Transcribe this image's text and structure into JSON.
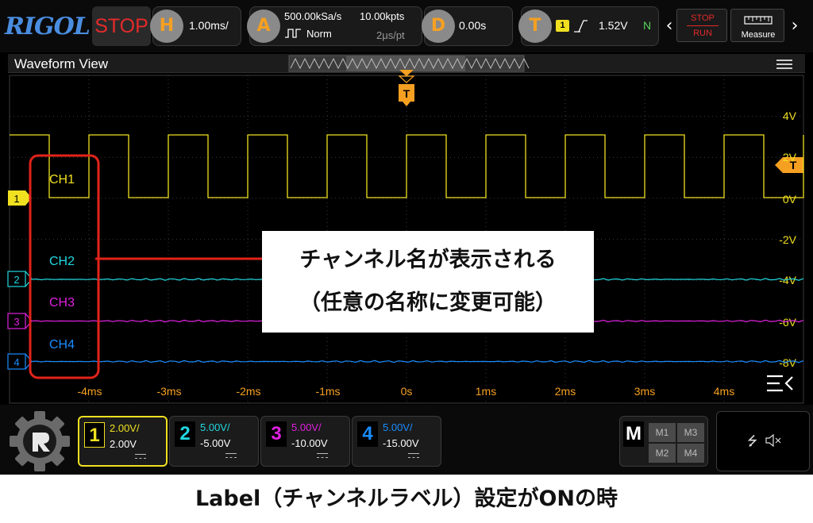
{
  "topbar": {
    "logo": "RIGOL",
    "run_state": "STOP",
    "horizontal": {
      "key": "H",
      "timebase": "1.00ms/"
    },
    "acquire": {
      "key": "A",
      "sample_rate": "500.00kSa/s",
      "memory_depth": "10.00kpts",
      "mode": "Norm",
      "time_per_point": "2μs/pt"
    },
    "delay": {
      "key": "D",
      "value": "0.00s"
    },
    "trigger": {
      "key": "T",
      "source": "1",
      "level": "1.52V",
      "sweep": "N"
    },
    "stop_run": {
      "stop": "STOP",
      "run": "RUN"
    },
    "measure_label": "Measure"
  },
  "waveform_view": {
    "title": "Waveform View",
    "trigger_marker": "T",
    "right_axis_labels": [
      "4V",
      "2V",
      "0V",
      "-2V",
      "-4V",
      "-6V",
      "-8V"
    ],
    "time_labels": [
      "-4ms",
      "-3ms",
      "-2ms",
      "-1ms",
      "0s",
      "1ms",
      "2ms",
      "3ms",
      "4ms"
    ],
    "channel_labels": [
      "CH1",
      "CH2",
      "CH3",
      "CH4"
    ],
    "channel_markers": [
      "1",
      "2",
      "3",
      "4"
    ]
  },
  "channels": [
    {
      "num": "1",
      "scale": "2.00V/",
      "offset": "2.00V",
      "color": "#f0e020",
      "active": true
    },
    {
      "num": "2",
      "scale": "5.00V/",
      "offset": "-5.00V",
      "color": "#20d8e0",
      "active": false
    },
    {
      "num": "3",
      "scale": "5.00V/",
      "offset": "-10.00V",
      "color": "#e020e0",
      "active": false
    },
    {
      "num": "4",
      "scale": "5.00V/",
      "offset": "-15.00V",
      "color": "#1a8cff",
      "active": false
    }
  ],
  "math": {
    "key": "M",
    "items": [
      "M1",
      "M3",
      "M2",
      "M4"
    ]
  },
  "annotation": {
    "line1": "チャンネル名が表示される",
    "line2": "（任意の名称に変更可能）"
  },
  "caption": "Label（チャンネルラベル）設定がONの時",
  "colors": {
    "ch1": "#f0e020",
    "ch2": "#20d8e0",
    "ch3": "#e020e0",
    "ch4": "#1a8cff",
    "accent": "#f6a021",
    "stop": "#e42a2a",
    "highlight": "#e2231a"
  },
  "icons": [
    "rigol-logo",
    "chevron-left-icon",
    "chevron-right-icon",
    "ruler-icon",
    "menu-icon",
    "collapse-icon",
    "usb-icon",
    "mute-icon",
    "gear-logo-icon"
  ]
}
